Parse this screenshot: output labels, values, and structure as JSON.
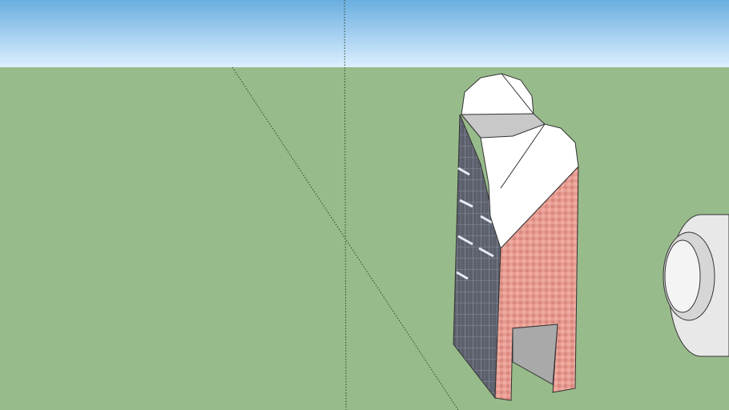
{
  "scene": {
    "colors": {
      "sky_top": "#6aaee0",
      "sky_horizon": "#dcefff",
      "ground": "#98bb8b",
      "glass": "#5a5e6a",
      "brick": "#e69a90",
      "roof": "#ffffff",
      "shadow": "#b8b8b8",
      "edge": "#333333"
    }
  }
}
